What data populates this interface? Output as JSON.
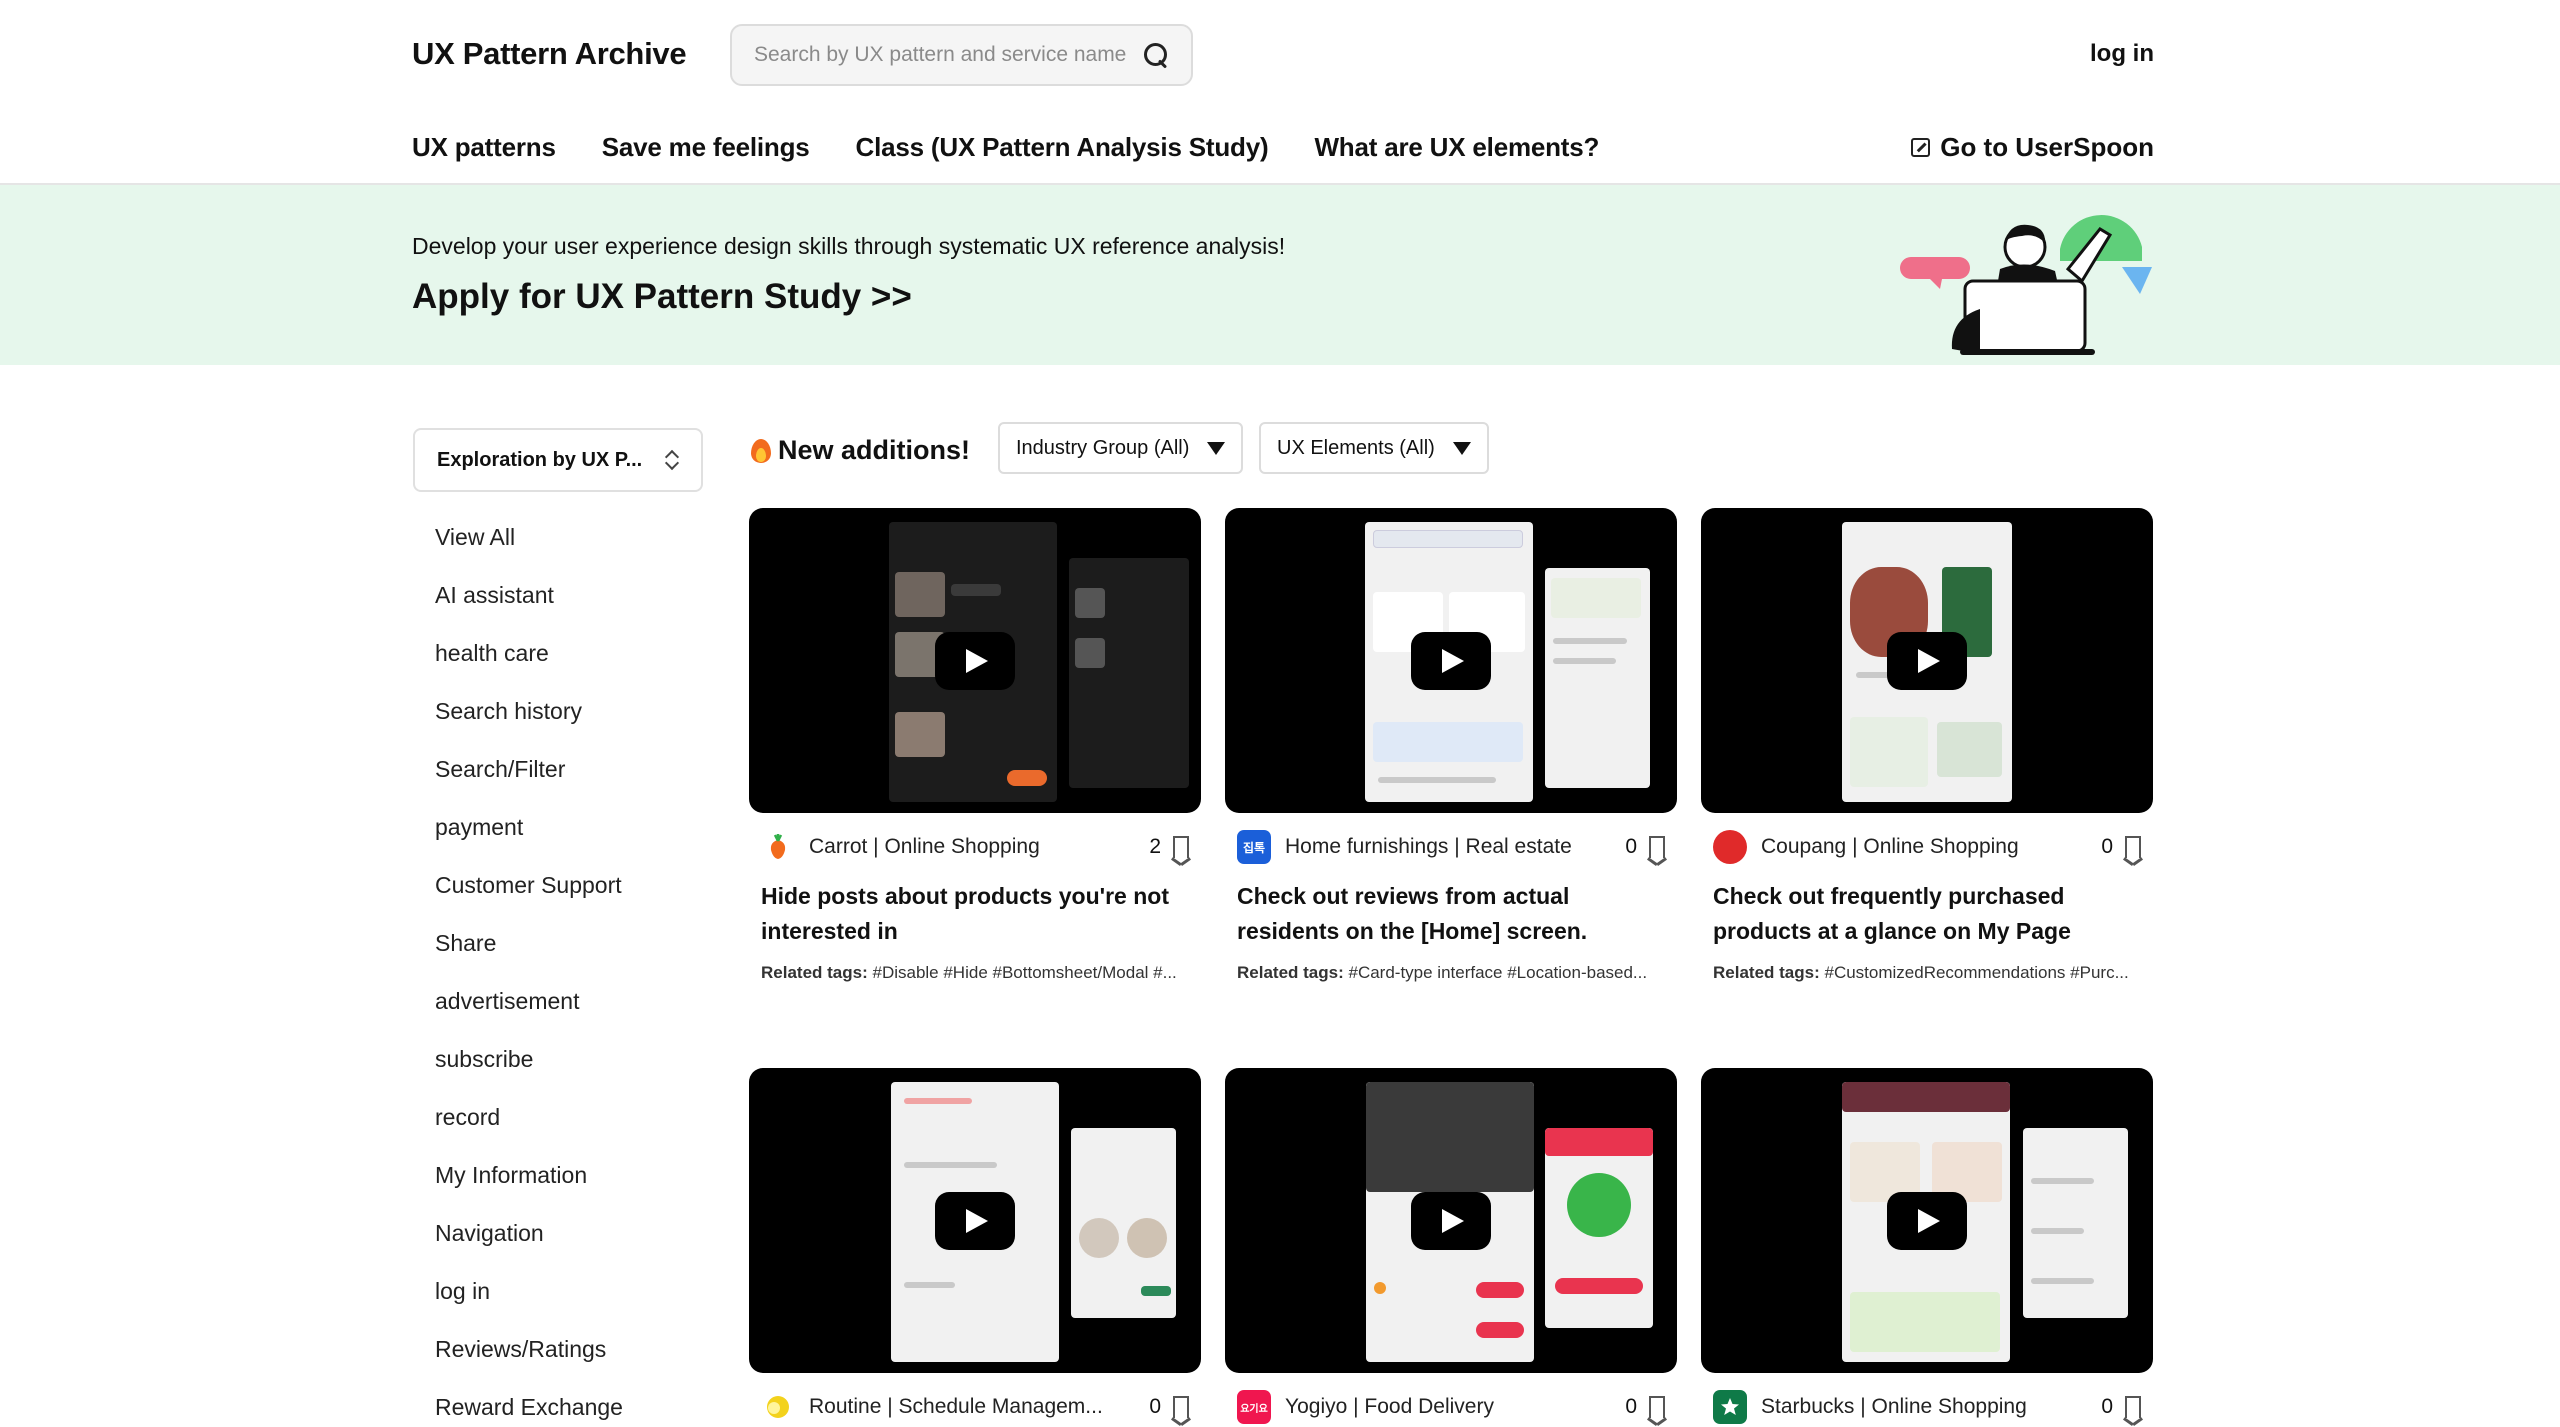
{
  "header": {
    "logo": "UX Pattern Archive",
    "search_placeholder": "Search by UX pattern and service name",
    "login": "log in",
    "nav": [
      "UX patterns",
      "Save me feelings",
      "Class (UX Pattern Analysis Study)",
      "What are UX elements?"
    ],
    "external_link": "Go to UserSpoon"
  },
  "banner": {
    "subtitle": "Develop your user experience design skills through systematic UX reference analysis!",
    "title": "Apply for UX Pattern Study >>"
  },
  "sidebar": {
    "selector": "Exploration by UX P...",
    "items": [
      "View All",
      "AI assistant",
      "health care",
      "Search history",
      "Search/Filter",
      "payment",
      "Customer Support",
      "Share",
      "advertisement",
      "subscribe",
      "record",
      "My Information",
      "Navigation",
      "log in",
      "Reviews/Ratings",
      "Reward Exchange"
    ]
  },
  "feed": {
    "heading": "New additions!",
    "filter_industry": "Industry Group (All)",
    "filter_elements": "UX Elements (All)",
    "tags_label": "Related tags:",
    "cards": [
      {
        "service": "Carrot | Online Shopping",
        "count": "2",
        "title": "Hide posts about products you're not interested in",
        "tags": "#Disable #Hide #Bottomsheet/Modal #...",
        "icon_color": "#ffffff",
        "icon_glyph": "🥕"
      },
      {
        "service": "Home furnishings | Real estate",
        "count": "0",
        "title": "Check out reviews from actual residents on the [Home] screen.",
        "tags": "#Card-type interface #Location-based...",
        "icon_color": "#1b5fd9",
        "icon_glyph": "집톡"
      },
      {
        "service": "Coupang | Online Shopping",
        "count": "0",
        "title": "Check out frequently purchased products at a glance on My Page",
        "tags": "#CustomizedRecommendations #Purc...",
        "icon_color": "#e02a2a",
        "icon_glyph": ""
      },
      {
        "service": "Routine | Schedule Managem...",
        "count": "0",
        "title": "",
        "tags": "",
        "icon_color": "#f3d21c",
        "icon_glyph": ""
      },
      {
        "service": "Yogiyo | Food Delivery",
        "count": "0",
        "title": "",
        "tags": "",
        "icon_color": "#f0164f",
        "icon_glyph": "요기요"
      },
      {
        "service": "Starbucks | Online Shopping",
        "count": "0",
        "title": "",
        "tags": "",
        "icon_color": "#0f7a48",
        "icon_glyph": ""
      }
    ]
  }
}
